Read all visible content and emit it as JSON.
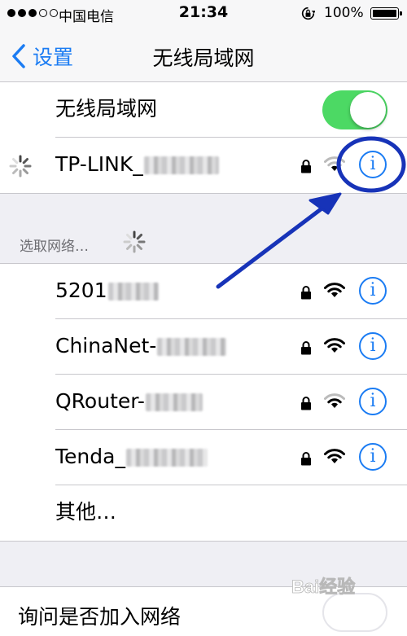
{
  "status_bar": {
    "carrier": "中国电信",
    "time": "21:34",
    "battery": "100%",
    "signal_bars": 3,
    "signal_total": 5
  },
  "nav": {
    "back_label": "设置",
    "title": "无线局域网"
  },
  "wifi_toggle": {
    "label": "无线局域网",
    "on": true
  },
  "connected_network": {
    "name": "TP-LINK_",
    "secured": true
  },
  "section_header": "选取网络…",
  "networks": [
    {
      "name": "5201",
      "secured": true
    },
    {
      "name": "ChinaNet-",
      "secured": true
    },
    {
      "name": "QRouter-",
      "secured": true
    },
    {
      "name": "Tenda_",
      "secured": true
    }
  ],
  "other_label": "其他…",
  "ask_to_join": {
    "label": "询问是否加入网络",
    "on": false
  },
  "info_glyph": "i",
  "colors": {
    "accent": "#1b7cf3",
    "toggle_on": "#4cd964",
    "annotation": "#1733b8",
    "background": "#efeff4"
  },
  "watermark": "Bai经验"
}
